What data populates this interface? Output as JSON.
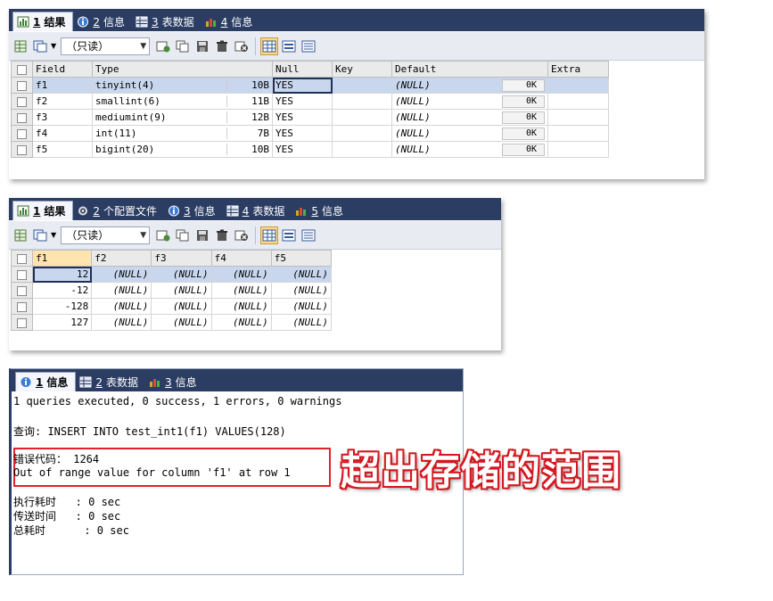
{
  "panel1": {
    "tabs": [
      {
        "num": "1",
        "label": " 结果",
        "icon": "result-icon"
      },
      {
        "num": "2",
        "label": " 信息",
        "icon": "info-icon"
      },
      {
        "num": "3",
        "label": " 表数据",
        "icon": "table-icon"
      },
      {
        "num": "4",
        "label": " 信息",
        "icon": "chart-icon"
      }
    ],
    "readonly": "（只读）",
    "columns": [
      "Field",
      "Type",
      "Null",
      "Key",
      "Default",
      "Extra"
    ],
    "rows": [
      {
        "field": "f1",
        "type": "tinyint(4)",
        "len": "10B",
        "null": "YES",
        "key": "",
        "default": "(NULL)",
        "ok": "0K",
        "extra": ""
      },
      {
        "field": "f2",
        "type": "smallint(6)",
        "len": "11B",
        "null": "YES",
        "key": "",
        "default": "(NULL)",
        "ok": "0K",
        "extra": ""
      },
      {
        "field": "f3",
        "type": "mediumint(9)",
        "len": "12B",
        "null": "YES",
        "key": "",
        "default": "(NULL)",
        "ok": "0K",
        "extra": ""
      },
      {
        "field": "f4",
        "type": "int(11)",
        "len": "7B",
        "null": "YES",
        "key": "",
        "default": "(NULL)",
        "ok": "0K",
        "extra": ""
      },
      {
        "field": "f5",
        "type": "bigint(20)",
        "len": "10B",
        "null": "YES",
        "key": "",
        "default": "(NULL)",
        "ok": "0K",
        "extra": ""
      }
    ]
  },
  "panel2": {
    "tabs": [
      {
        "num": "1",
        "label": " 结果",
        "icon": "result-icon"
      },
      {
        "num": "2",
        "label": " 个配置文件",
        "icon": "profile-icon"
      },
      {
        "num": "3",
        "label": " 信息",
        "icon": "info-icon"
      },
      {
        "num": "4",
        "label": " 表数据",
        "icon": "table-icon"
      },
      {
        "num": "5",
        "label": " 信息",
        "icon": "chart-icon"
      }
    ],
    "readonly": "（只读）",
    "columns": [
      "f1",
      "f2",
      "f3",
      "f4",
      "f5"
    ],
    "rows": [
      [
        "12",
        "(NULL)",
        "(NULL)",
        "(NULL)",
        "(NULL)"
      ],
      [
        "-12",
        "(NULL)",
        "(NULL)",
        "(NULL)",
        "(NULL)"
      ],
      [
        "-128",
        "(NULL)",
        "(NULL)",
        "(NULL)",
        "(NULL)"
      ],
      [
        "127",
        "(NULL)",
        "(NULL)",
        "(NULL)",
        "(NULL)"
      ]
    ]
  },
  "panel3": {
    "tabs": [
      {
        "num": "1",
        "label": " 信息",
        "icon": "info-icon"
      },
      {
        "num": "2",
        "label": " 表数据",
        "icon": "table-icon"
      },
      {
        "num": "3",
        "label": " 信息",
        "icon": "chart-icon"
      }
    ],
    "summary": "1 queries executed, 0 success, 1 errors, 0 warnings",
    "query": "查询: INSERT INTO test_int1(f1) VALUES(128)",
    "error_code": "错误代码： 1264",
    "error_msg": "Out of range value for column 'f1' at row 1",
    "exec_time": "执行耗时   : 0 sec",
    "transfer_time": "传送时间   : 0 sec",
    "total_time": "总耗时      : 0 sec"
  },
  "annotation": "超出存储的范围",
  "colors": {
    "tabbar": "#2b3d63",
    "error_border": "#e8202a",
    "annotation": "#d4171f",
    "selected_row": "#c8d7ee"
  }
}
